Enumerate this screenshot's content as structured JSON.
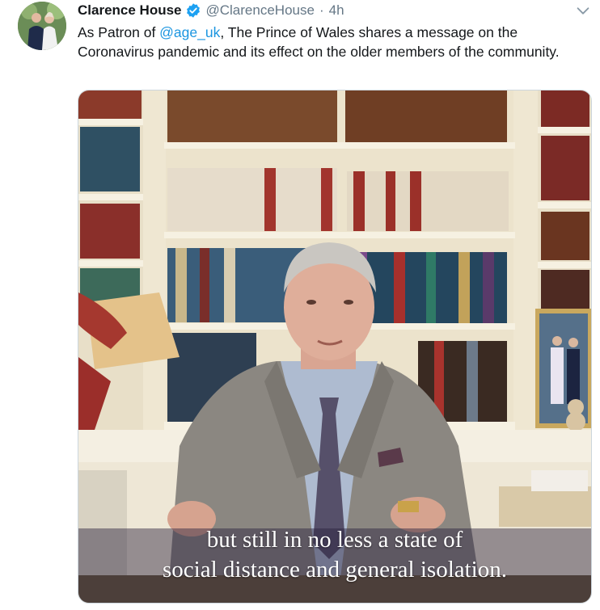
{
  "tweet": {
    "author_name": "Clarence House",
    "author_handle": "@ClarenceHouse",
    "separator": "·",
    "timestamp": "4h",
    "text_before": "As Patron of ",
    "mention": "@age_uk",
    "text_after": ", The Prince of Wales shares a message on the Coronavirus pandemic and its effect on the older members of the community.",
    "verified": true
  },
  "video": {
    "caption_line_1": "but still in no less a state of",
    "caption_line_2": "social distance and general isolation."
  },
  "icons": {
    "verified": "verified-badge-icon",
    "more": "chevron-down-icon"
  },
  "colors": {
    "link": "#1b95e0",
    "verified": "#1da1f2",
    "secondary_text": "#657786"
  }
}
